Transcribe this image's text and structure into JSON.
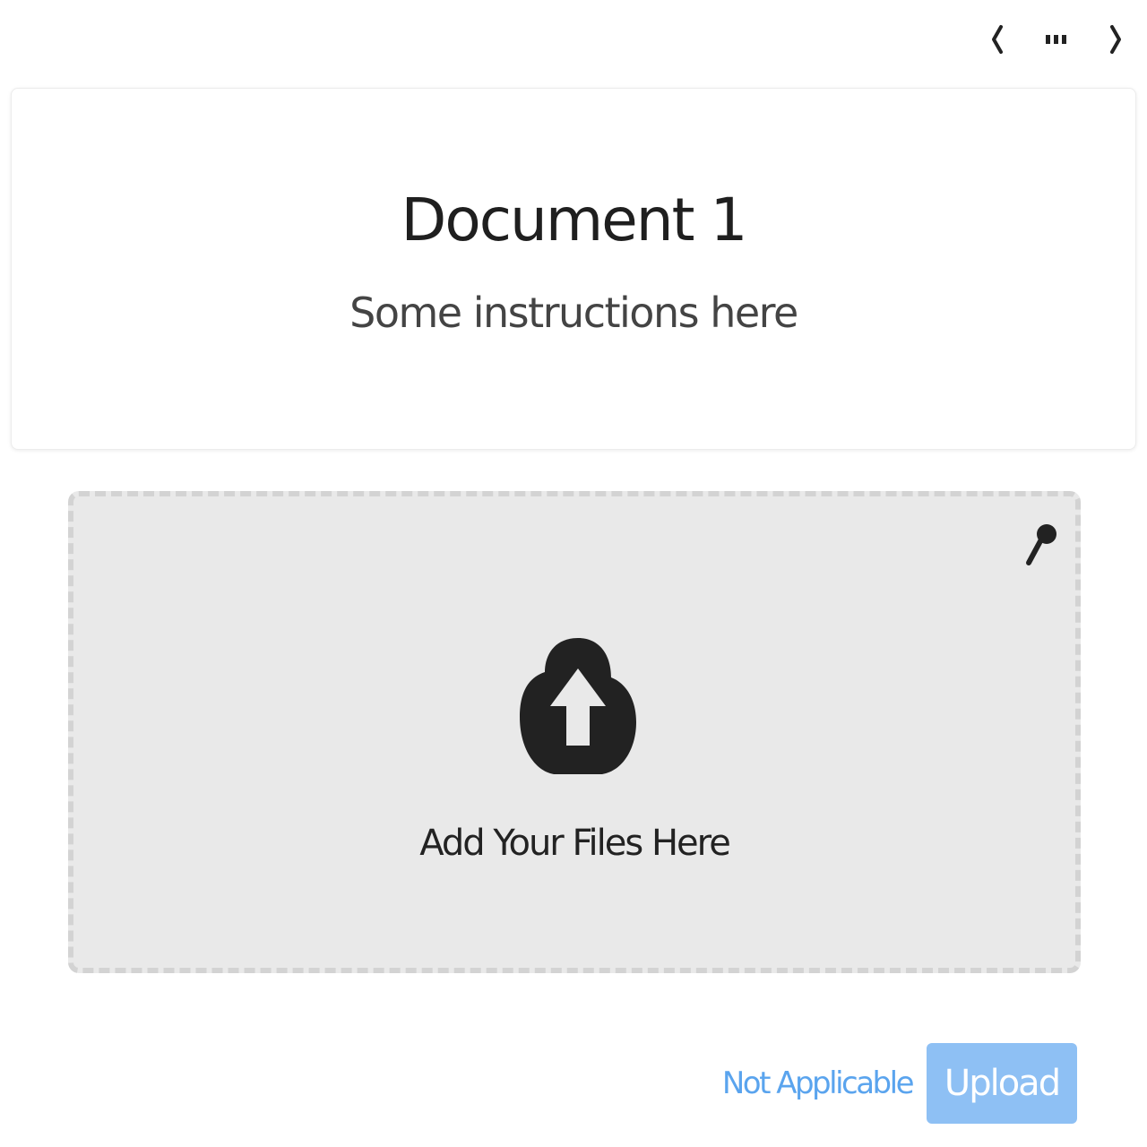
{
  "pager": {
    "prev_icon": "chevron-left-icon",
    "menu_icon": "dots-icon",
    "next_icon": "chevron-right-icon"
  },
  "card": {
    "title": "Document 1",
    "instructions": "Some instructions here"
  },
  "dropzone": {
    "label": "Add Your Files Here",
    "icon": "cloud-upload-icon",
    "corner_icon": "pin-icon"
  },
  "footer": {
    "not_applicable_label": "Not Applicable",
    "upload_label": "Upload"
  },
  "colors": {
    "accent": "#5aa4ee",
    "upload_disabled_bg": "#8ec0f4",
    "dropzone_bg": "#e9e9e9"
  }
}
